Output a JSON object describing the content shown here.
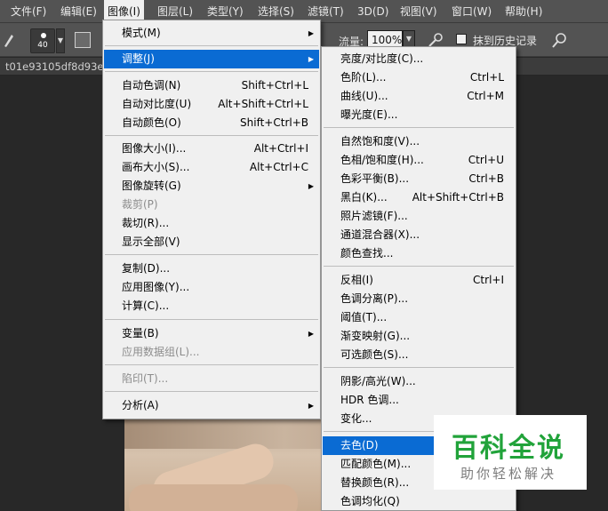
{
  "menubar": {
    "items": [
      {
        "label": "文件(F)"
      },
      {
        "label": "编辑(E)"
      },
      {
        "label": "图像(I)"
      },
      {
        "label": "图层(L)"
      },
      {
        "label": "类型(Y)"
      },
      {
        "label": "选择(S)"
      },
      {
        "label": "滤镜(T)"
      },
      {
        "label": "3D(D)"
      },
      {
        "label": "视图(V)"
      },
      {
        "label": "窗口(W)"
      },
      {
        "label": "帮助(H)"
      }
    ]
  },
  "options": {
    "brush_size": "40",
    "flow_label": "流量:",
    "flow_value": "100%",
    "history_label": "抹到历史记录"
  },
  "document": {
    "tab_title": "t01e93105df8d93e"
  },
  "image_menu": {
    "items": [
      {
        "label": "模式(M)",
        "shortcut": "",
        "submenu": true
      },
      {
        "label": "调整(J)",
        "shortcut": "",
        "submenu": true
      },
      {
        "label": "自动色调(N)",
        "shortcut": "Shift+Ctrl+L"
      },
      {
        "label": "自动对比度(U)",
        "shortcut": "Alt+Shift+Ctrl+L"
      },
      {
        "label": "自动颜色(O)",
        "shortcut": "Shift+Ctrl+B"
      },
      {
        "label": "图像大小(I)...",
        "shortcut": "Alt+Ctrl+I"
      },
      {
        "label": "画布大小(S)...",
        "shortcut": "Alt+Ctrl+C"
      },
      {
        "label": "图像旋转(G)",
        "shortcut": "",
        "submenu": true
      },
      {
        "label": "裁剪(P)",
        "shortcut": ""
      },
      {
        "label": "裁切(R)...",
        "shortcut": ""
      },
      {
        "label": "显示全部(V)",
        "shortcut": ""
      },
      {
        "label": "复制(D)...",
        "shortcut": ""
      },
      {
        "label": "应用图像(Y)...",
        "shortcut": ""
      },
      {
        "label": "计算(C)...",
        "shortcut": ""
      },
      {
        "label": "变量(B)",
        "shortcut": "",
        "submenu": true
      },
      {
        "label": "应用数据组(L)...",
        "shortcut": ""
      },
      {
        "label": "陷印(T)...",
        "shortcut": ""
      },
      {
        "label": "分析(A)",
        "shortcut": "",
        "submenu": true
      }
    ]
  },
  "adjust_menu": {
    "items": [
      {
        "label": "亮度/对比度(C)...",
        "shortcut": ""
      },
      {
        "label": "色阶(L)...",
        "shortcut": "Ctrl+L"
      },
      {
        "label": "曲线(U)...",
        "shortcut": "Ctrl+M"
      },
      {
        "label": "曝光度(E)...",
        "shortcut": ""
      },
      {
        "label": "自然饱和度(V)...",
        "shortcut": ""
      },
      {
        "label": "色相/饱和度(H)...",
        "shortcut": "Ctrl+U"
      },
      {
        "label": "色彩平衡(B)...",
        "shortcut": "Ctrl+B"
      },
      {
        "label": "黑白(K)...",
        "shortcut": "Alt+Shift+Ctrl+B"
      },
      {
        "label": "照片滤镜(F)...",
        "shortcut": ""
      },
      {
        "label": "通道混合器(X)...",
        "shortcut": ""
      },
      {
        "label": "颜色查找...",
        "shortcut": ""
      },
      {
        "label": "反相(I)",
        "shortcut": "Ctrl+I"
      },
      {
        "label": "色调分离(P)...",
        "shortcut": ""
      },
      {
        "label": "阈值(T)...",
        "shortcut": ""
      },
      {
        "label": "渐变映射(G)...",
        "shortcut": ""
      },
      {
        "label": "可选颜色(S)...",
        "shortcut": ""
      },
      {
        "label": "阴影/高光(W)...",
        "shortcut": ""
      },
      {
        "label": "HDR 色调...",
        "shortcut": ""
      },
      {
        "label": "变化...",
        "shortcut": ""
      },
      {
        "label": "去色(D)",
        "shortcut": ""
      },
      {
        "label": "匹配颜色(M)...",
        "shortcut": ""
      },
      {
        "label": "替换颜色(R)...",
        "shortcut": ""
      },
      {
        "label": "色调均化(Q)",
        "shortcut": ""
      }
    ]
  },
  "watermark": {
    "title": "百科全说",
    "subtitle": "助你轻松解决"
  },
  "colors": {
    "menu_highlight": "#0a6bd3",
    "watermark_green": "#21a33a"
  }
}
